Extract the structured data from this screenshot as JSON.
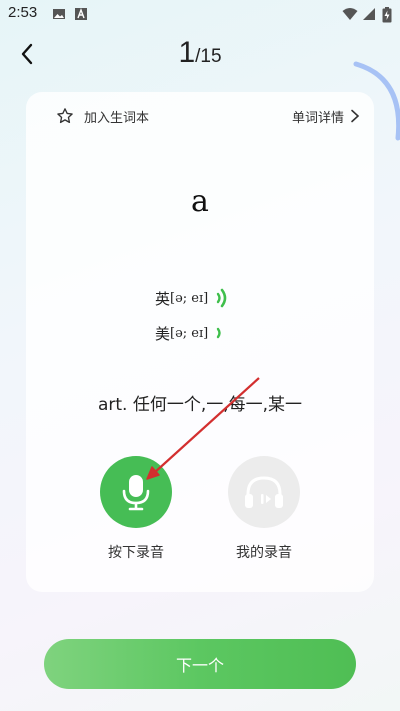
{
  "status_bar": {
    "time": "2:53"
  },
  "header": {
    "current": "1",
    "total": "/15"
  },
  "card": {
    "add_vocab_label": "加入生词本",
    "detail_label": "单词详情",
    "word": "a",
    "phonetics": [
      {
        "region": "英",
        "ipa": "[ə; eɪ]"
      },
      {
        "region": "美",
        "ipa": "[ə; eɪ]"
      }
    ],
    "definition": "art.  任何一个,一,每一,某一",
    "record_label": "按下录音",
    "my_recording_label": "我的录音"
  },
  "footer": {
    "next_label": "下一个"
  },
  "colors": {
    "accent": "#46bd55",
    "arrow": "#d32f2f"
  }
}
